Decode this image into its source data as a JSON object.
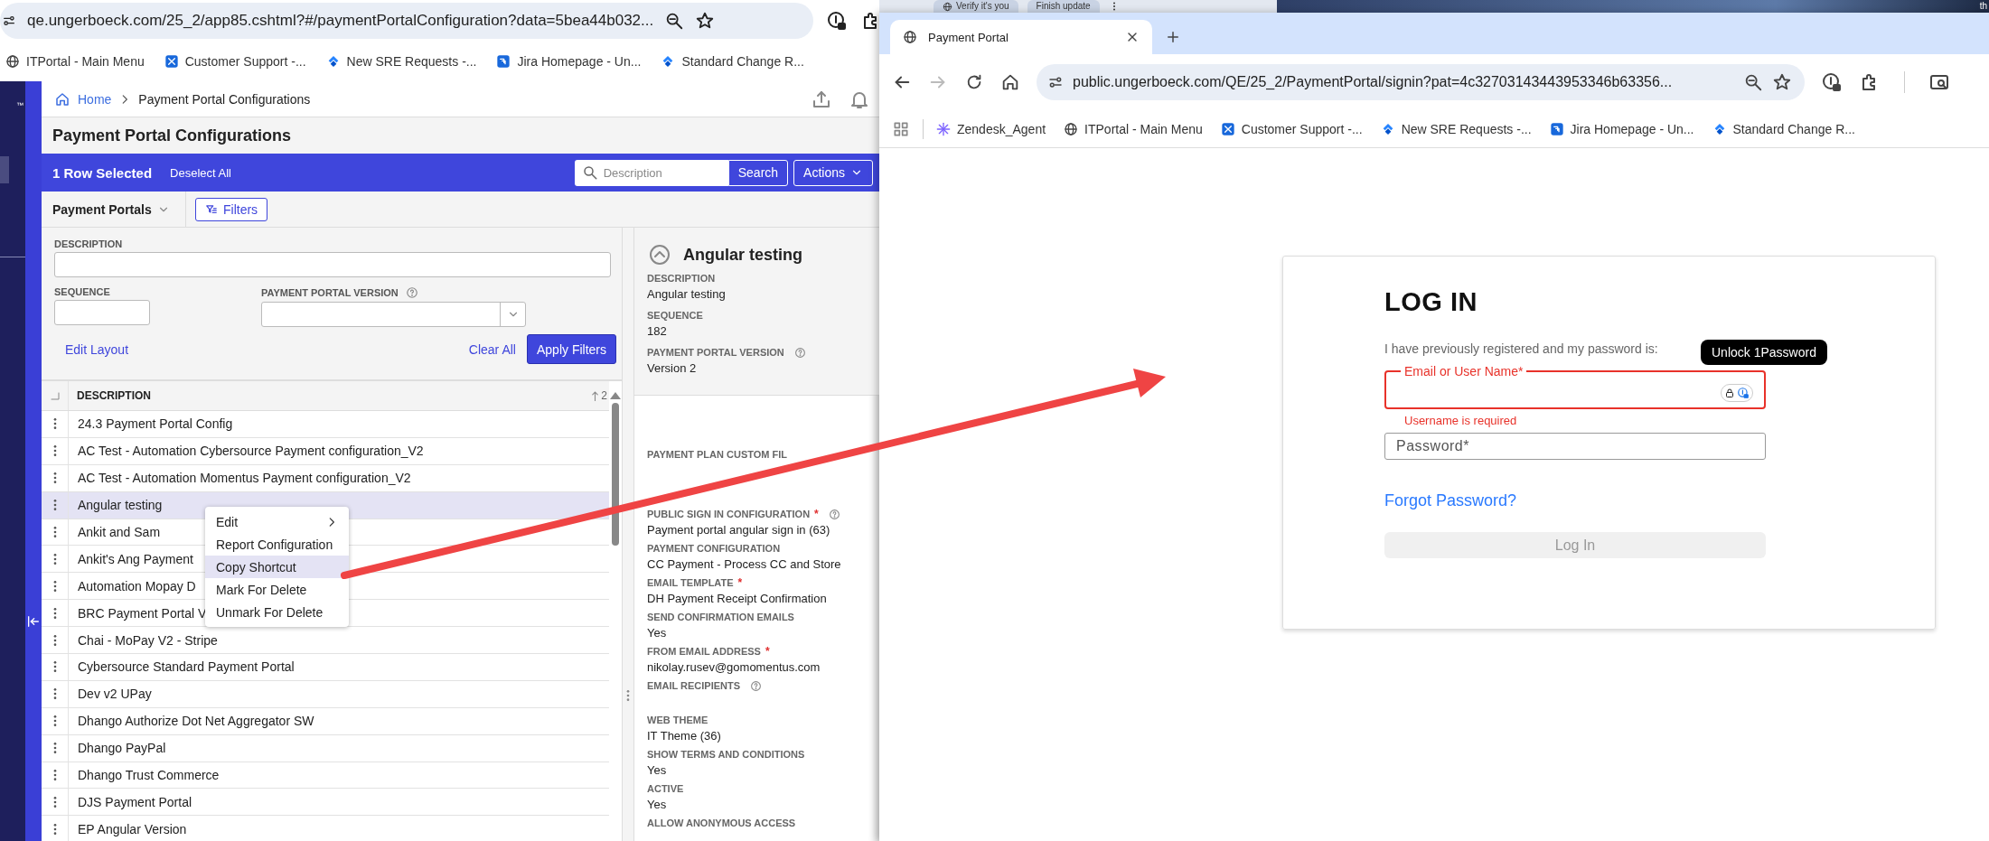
{
  "left_browser": {
    "address": "qe.ungerboeck.com/25_2/app85.cshtml?#/paymentPortalConfiguration?data=5bea44b032...",
    "bookmarks": [
      {
        "label": "ITPortal - Main Menu",
        "kind": "globe"
      },
      {
        "label": "Customer Support -...",
        "kind": "service"
      },
      {
        "label": "New SRE Requests -...",
        "kind": "jira"
      },
      {
        "label": "Jira Homepage - Un...",
        "kind": "jira-square"
      },
      {
        "label": "Standard Change R...",
        "kind": "jira"
      }
    ],
    "background_tabs": [
      "Verify it's you",
      "Finish update"
    ],
    "desktop_text": "th"
  },
  "sidebar": {
    "logo_fragment": "™"
  },
  "breadcrumb": [
    {
      "label": "Home",
      "kind": "home"
    },
    {
      "label": "Payment Portal Configurations",
      "kind": "current"
    }
  ],
  "page_title": "Payment Portal Configurations",
  "selection_bar": {
    "count_label": "1 Row Selected",
    "deselect": "Deselect All",
    "search_placeholder": "Description",
    "search_button": "Search",
    "actions": "Actions"
  },
  "toolbar": {
    "view": "Payment Portals",
    "filters": "Filters"
  },
  "filters": {
    "description_label": "DESCRIPTION",
    "sequence_label": "SEQUENCE",
    "version_label": "PAYMENT PORTAL VERSION",
    "edit_layout": "Edit Layout",
    "clear_all": "Clear All",
    "apply": "Apply Filters"
  },
  "table": {
    "columns": [
      "DESCRIPTION"
    ],
    "sort_order": "2",
    "rows": [
      {
        "description": "24.3 Payment Portal Config",
        "selected": false
      },
      {
        "description": "AC Test - Automation Cybersource Payment configuration_V2",
        "selected": false
      },
      {
        "description": "AC Test - Automation Momentus Payment configuration_V2",
        "selected": false
      },
      {
        "description": "Angular testing",
        "selected": true
      },
      {
        "description": "Ankit and Sam",
        "selected": false
      },
      {
        "description": "Ankit's Ang Payment",
        "selected": false
      },
      {
        "description": "Automation Mopay D",
        "selected": false
      },
      {
        "description": "BRC Payment Portal V",
        "selected": false
      },
      {
        "description": "Chai - MoPay V2 - Stripe",
        "selected": false
      },
      {
        "description": "Cybersource Standard Payment Portal",
        "selected": false
      },
      {
        "description": "Dev v2 UPay",
        "selected": false
      },
      {
        "description": "Dhango Authorize Dot Net Aggregator SW",
        "selected": false
      },
      {
        "description": "Dhango PayPal",
        "selected": false
      },
      {
        "description": "Dhango Trust Commerce",
        "selected": false
      },
      {
        "description": "DJS Payment Portal",
        "selected": false
      },
      {
        "description": "EP Angular Version",
        "selected": false
      }
    ]
  },
  "context_menu": {
    "items": [
      {
        "label": "Edit",
        "submenu": true,
        "highlighted": false
      },
      {
        "label": "Report Configuration",
        "submenu": false,
        "highlighted": false
      },
      {
        "label": "Copy Shortcut",
        "submenu": false,
        "highlighted": true
      },
      {
        "label": "Mark For Delete",
        "submenu": false,
        "highlighted": false
      },
      {
        "label": "Unmark For Delete",
        "submenu": false,
        "highlighted": false
      }
    ]
  },
  "details": {
    "title": "Angular testing",
    "sections": [
      {
        "kind": "summary",
        "fields": [
          {
            "label": "DESCRIPTION",
            "value": "Angular testing",
            "help": false
          },
          {
            "label": "SEQUENCE",
            "value": "182",
            "help": false
          },
          {
            "label": "PAYMENT PORTAL VERSION",
            "value": "Version 2",
            "help": true
          }
        ]
      },
      {
        "kind": "main",
        "fields": [
          {
            "label": "PAYMENT PLAN CUSTOM FIL",
            "help": false
          },
          {
            "label": "PUBLIC SIGN IN CONFIGURATION",
            "required_mark": "*",
            "value": "Payment portal angular sign in (63)",
            "help": true
          },
          {
            "label": "PAYMENT CONFIGURATION",
            "value": "CC Payment - Process CC and Store",
            "help": false
          },
          {
            "label": "EMAIL TEMPLATE",
            "required_mark": "*",
            "value": "DH Payment Receipt Confirmation",
            "help": false
          },
          {
            "label": "SEND CONFIRMATION EMAILS",
            "value": "Yes",
            "help": false
          },
          {
            "label": "FROM EMAIL ADDRESS",
            "required_mark": "*",
            "value": "nikolay.rusev@gomomentus.com",
            "help": false
          },
          {
            "label": "EMAIL RECIPIENTS",
            "help": true
          },
          {
            "label": "WEB THEME",
            "value": "IT Theme (36)",
            "help": false
          },
          {
            "label": "SHOW TERMS AND CONDITIONS",
            "value": "Yes",
            "help": false
          },
          {
            "label": "ACTIVE",
            "value": "Yes",
            "help": false
          },
          {
            "label": "ALLOW ANONYMOUS ACCESS",
            "help": false
          }
        ]
      }
    ]
  },
  "login_window": {
    "tab_title": "Payment Portal",
    "forward_disabled": true,
    "address": "public.ungerboeck.com/QE/25_2/PaymentPortal/signin?pat=4c32703143443953346b63356...",
    "bookmarks": [
      {
        "label": "Zendesk_Agent",
        "kind": "zendesk"
      },
      {
        "label": "ITPortal - Main Menu",
        "kind": "globe"
      },
      {
        "label": "Customer Support -...",
        "kind": "service"
      },
      {
        "label": "New SRE Requests -...",
        "kind": "jira"
      },
      {
        "label": "Jira Homepage - Un...",
        "kind": "jira-square"
      },
      {
        "label": "Standard Change R...",
        "kind": "jira"
      }
    ],
    "card": {
      "title": "LOG IN",
      "intro": "I have previously registered and my password is:",
      "username": {
        "label": "Email or User Name*",
        "error": "Username is required",
        "invalid": true
      },
      "password": {
        "placeholder": "Password*"
      },
      "forgot": "Forgot Password?",
      "submit": {
        "label": "Log In",
        "disabled": true
      }
    },
    "tooltip": "Unlock 1Password"
  }
}
